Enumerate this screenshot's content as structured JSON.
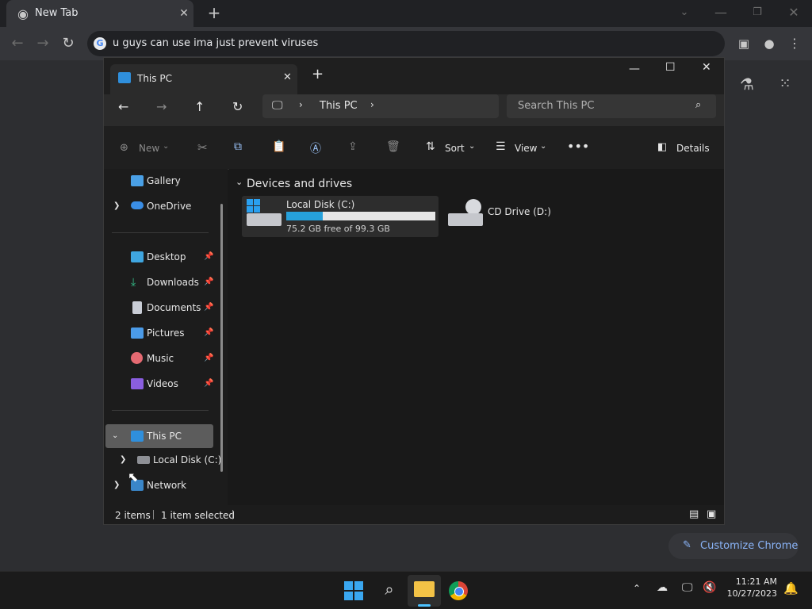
{
  "chrome": {
    "tab_title": "New Tab",
    "omnibox_text": "u guys can use ima just prevent viruses",
    "customize_label": "Customize Chrome"
  },
  "explorer": {
    "tab_title": "This PC",
    "breadcrumb": [
      "This PC"
    ],
    "search_placeholder": "Search This PC",
    "toolbar": {
      "new_label": "New",
      "sort_label": "Sort",
      "view_label": "View",
      "details_label": "Details"
    },
    "nav": {
      "items_top": [
        {
          "label": "Gallery"
        },
        {
          "label": "OneDrive"
        }
      ],
      "pinned": [
        {
          "label": "Desktop"
        },
        {
          "label": "Downloads"
        },
        {
          "label": "Documents"
        },
        {
          "label": "Pictures"
        },
        {
          "label": "Music"
        },
        {
          "label": "Videos"
        }
      ],
      "tree": [
        {
          "label": "This PC"
        },
        {
          "label": "Local Disk (C:)"
        },
        {
          "label": "Network"
        }
      ]
    },
    "content": {
      "section_title": "Devices and drives",
      "drives": [
        {
          "name": "Local Disk (C:)",
          "free_text": "75.2 GB free of 99.3 GB",
          "used_fraction": 0.243
        },
        {
          "name": "CD Drive (D:)"
        }
      ]
    },
    "status": {
      "item_count": "2 items",
      "selection": "1 item selected"
    }
  },
  "taskbar": {
    "time": "11:21 AM",
    "date": "10/27/2023"
  },
  "colors": {
    "accent": "#4cc2ff",
    "drive_bar": "#26a0da",
    "selected_bg": "#5c5c5c"
  }
}
